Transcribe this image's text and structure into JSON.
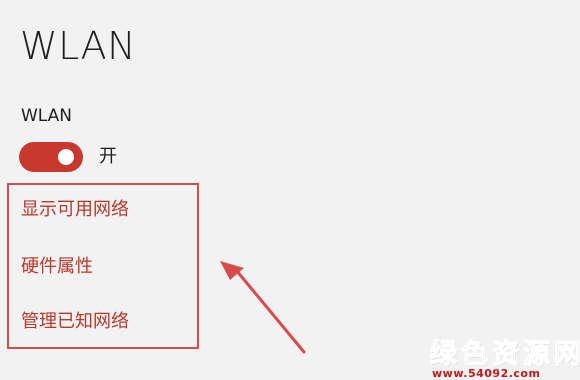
{
  "page": {
    "title": "WLAN"
  },
  "wlan": {
    "label": "WLAN",
    "toggle_state_label": "开",
    "toggle_on": true
  },
  "links": [
    {
      "label": "显示可用网络"
    },
    {
      "label": "硬件属性"
    },
    {
      "label": "管理已知网络"
    }
  ],
  "watermark": {
    "title": "绿色资源网",
    "url": "www.54092.com"
  },
  "colors": {
    "background": "#f2f2f2",
    "accent": "#c8382f",
    "link": "#b9382a",
    "annotation_red": "#d94a4a",
    "watermark_green": "#2aa32a",
    "watermark_red": "#c01a1a"
  }
}
